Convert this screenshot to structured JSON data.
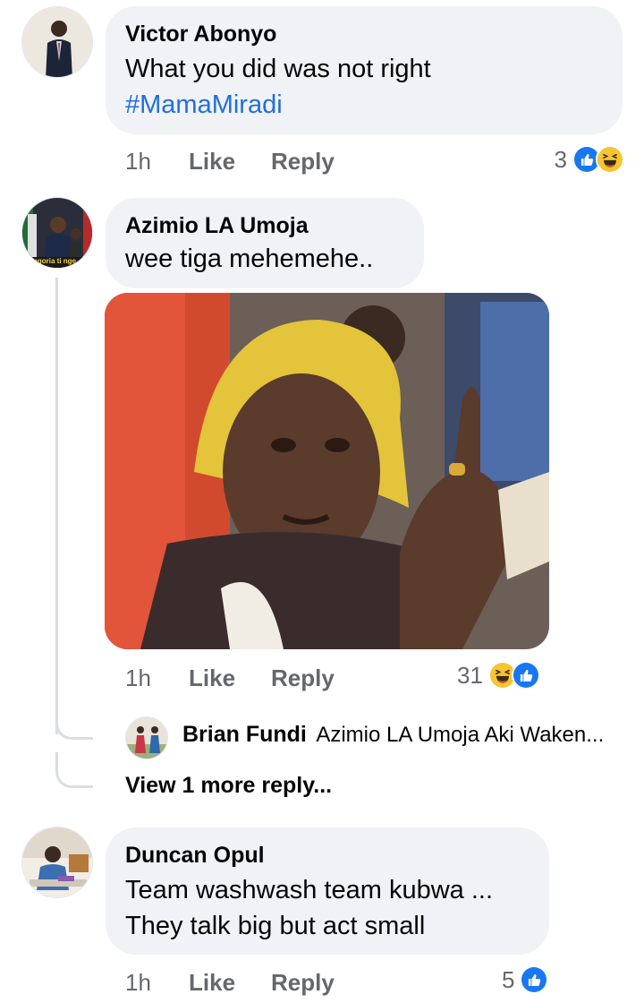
{
  "comments": [
    {
      "author": "Victor Abonyo",
      "text": "What you did was not right",
      "hashtag": "#MamaMiradi",
      "time": "1h",
      "like_label": "Like",
      "reply_label": "Reply",
      "reaction_count": "3",
      "reactions": [
        "like-icon",
        "haha-icon"
      ]
    },
    {
      "author": "Azimio LA Umoja",
      "text": "wee tiga mehemehe..",
      "avatar_caption": "ngoria ti nge",
      "time": "1h",
      "like_label": "Like",
      "reply_label": "Reply",
      "reaction_count": "31",
      "reactions": [
        "haha-icon",
        "like-icon"
      ],
      "reply_preview": {
        "author": "Brian Fundi",
        "text": "Azimio LA Umoja Aki Waken..."
      },
      "view_more_label": "View 1 more reply..."
    },
    {
      "author": "Duncan Opul",
      "text_line1": "Team washwash team kubwa ...",
      "text_line2": "They talk big but act small",
      "time": "1h",
      "like_label": "Like",
      "reply_label": "Reply",
      "reaction_count": "5",
      "reactions": [
        "like-icon"
      ]
    }
  ],
  "colors": {
    "bubble": "#f0f2f5",
    "link": "#216fdb",
    "meta": "#65676b",
    "like_blue": "#1877f2",
    "haha_yellow": "#f7c531"
  }
}
